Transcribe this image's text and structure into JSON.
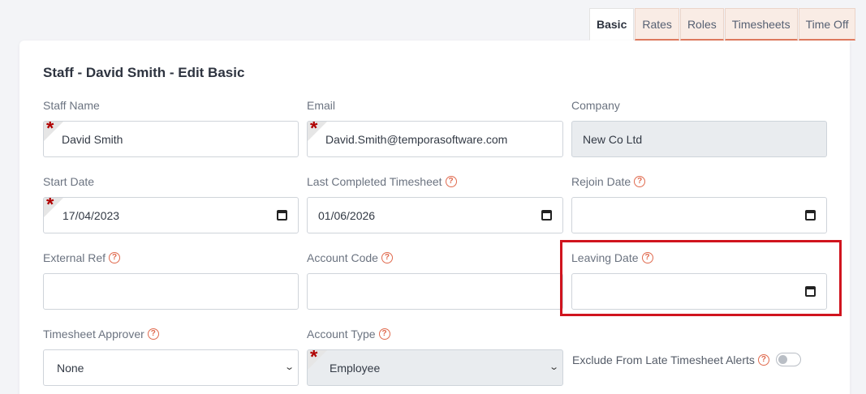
{
  "tabs": [
    {
      "label": "Basic",
      "active": true
    },
    {
      "label": "Rates"
    },
    {
      "label": "Roles"
    },
    {
      "label": "Timesheets"
    },
    {
      "label": "Time Off"
    }
  ],
  "page_title": "Staff - David Smith - Edit Basic",
  "required_marker": "*",
  "help_icon_glyph": "?",
  "fields": {
    "staff_name": {
      "label": "Staff Name",
      "value": "David Smith"
    },
    "email": {
      "label": "Email",
      "value": "David.Smith@temporasoftware.com"
    },
    "company": {
      "label": "Company",
      "value": "New Co Ltd"
    },
    "start_date": {
      "label": "Start Date",
      "value": "17/04/2023"
    },
    "last_completed_timesheet": {
      "label": "Last Completed Timesheet",
      "value": "01/06/2026"
    },
    "rejoin_date": {
      "label": "Rejoin Date",
      "value": ""
    },
    "external_ref": {
      "label": "External Ref",
      "value": ""
    },
    "account_code": {
      "label": "Account Code",
      "value": ""
    },
    "leaving_date": {
      "label": "Leaving Date",
      "value": ""
    },
    "timesheet_approver": {
      "label": "Timesheet Approver",
      "value": "None"
    },
    "account_type": {
      "label": "Account Type",
      "value": "Employee"
    },
    "exclude_late_alerts": {
      "label": "Exclude From Late Timesheet Alerts",
      "checked": false
    }
  },
  "colors": {
    "accent": "#e07a5f",
    "highlight": "#d0141e",
    "required": "#b00000"
  }
}
